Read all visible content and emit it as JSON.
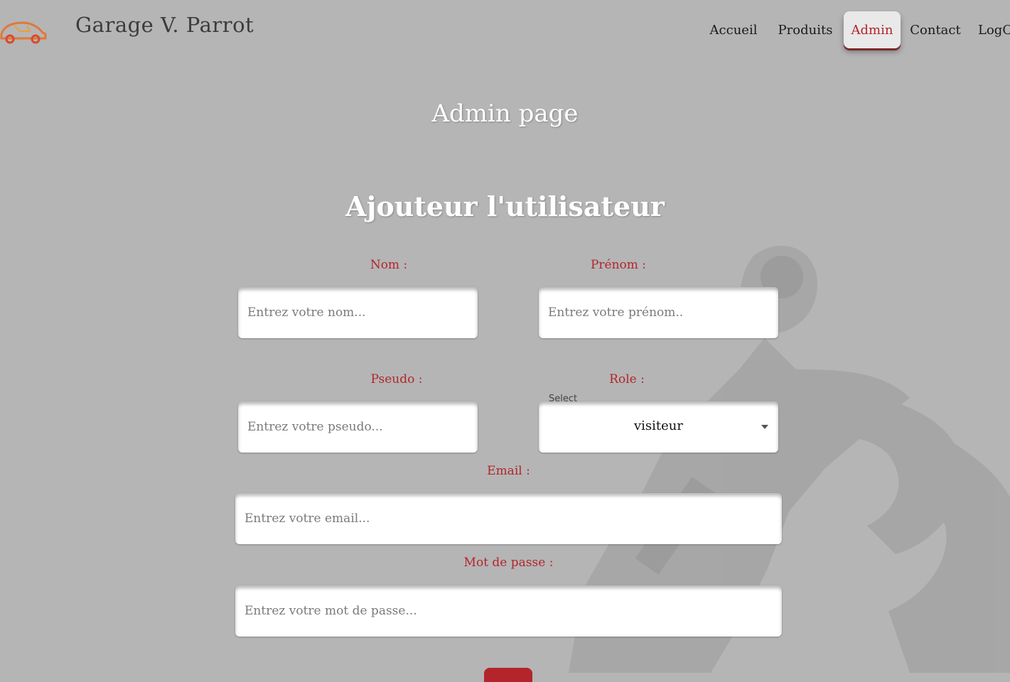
{
  "header": {
    "brand": "Garage V. Parrot",
    "nav": [
      "Accueil",
      "Produits",
      "Admin",
      "Contact",
      "LogOut"
    ],
    "active_nav": "Admin"
  },
  "page": {
    "title": "Admin page",
    "form_title": "Ajouteur l'utilisateur"
  },
  "form": {
    "nom": {
      "label": "Nom :",
      "placeholder": "Entrez votre nom..."
    },
    "prenom": {
      "label": "Prénom :",
      "placeholder": "Entrez votre prénom.."
    },
    "pseudo": {
      "label": "Pseudo :",
      "placeholder": "Entrez votre pseudo..."
    },
    "role": {
      "label": "Role :",
      "caption": "Select",
      "value": "visiteur"
    },
    "email": {
      "label": "Email :",
      "placeholder": "Entrez votre email..."
    },
    "password": {
      "label": "Mot de passe :",
      "placeholder": "Entrez votre mot de passe..."
    }
  },
  "colors": {
    "accent": "#b3252b",
    "background": "#b5b5b5"
  }
}
